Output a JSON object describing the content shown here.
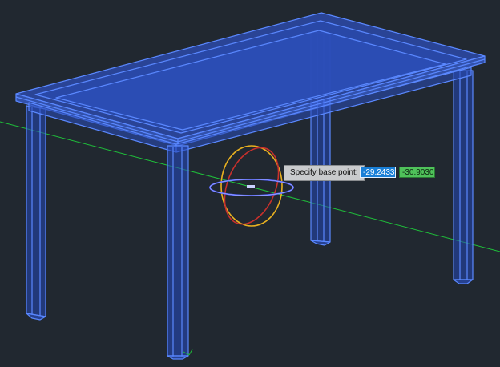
{
  "prompt": {
    "label": "Specify base point:",
    "x_value": "-29.2433",
    "y_value": "-30.9030"
  },
  "colors": {
    "background": "#212830",
    "wireframe": "#4b7cff",
    "table_top_fill": "#2c49a8",
    "ucs_axis": "#1fbf3a",
    "gizmo_red": "#c9302c",
    "gizmo_yellow": "#e8b020",
    "gizmo_blue": "#5060ff"
  },
  "icons": [
    "move-gizmo-icon",
    "ucs-origin-icon"
  ]
}
